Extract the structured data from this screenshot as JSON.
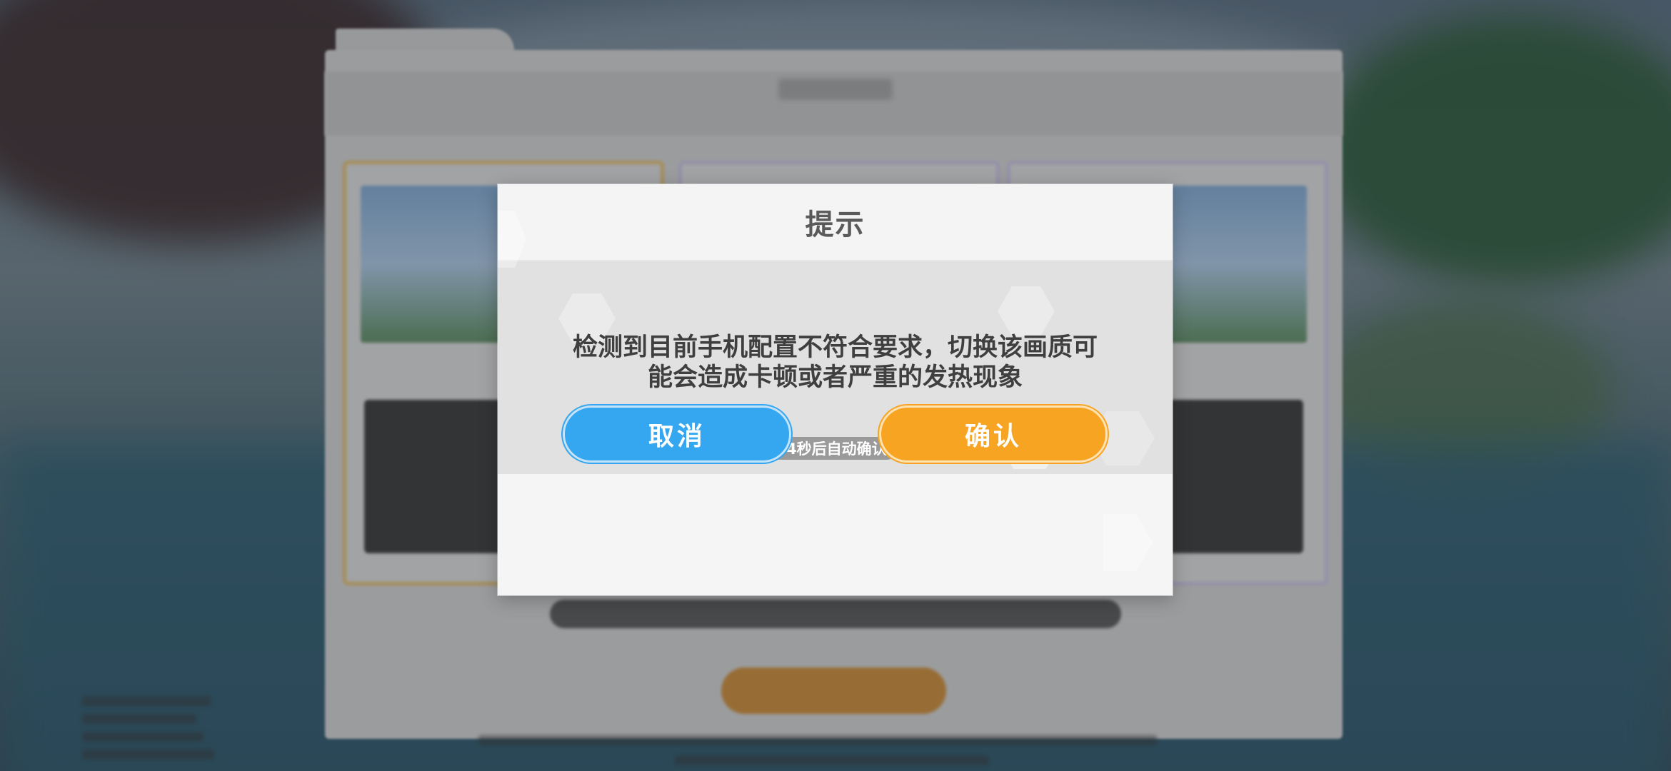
{
  "dialog": {
    "title": "提示",
    "message_line1": "检测到目前手机配置不符合要求，切换该画质可",
    "message_line2": "能会造成卡顿或者严重的发热现象",
    "countdown": "4秒后自动确认",
    "cancel_label": "取消",
    "confirm_label": "确认"
  },
  "icons": {
    "countdown": "alert-circle-icon"
  },
  "colors": {
    "cancel_button": "#35a6f0",
    "confirm_button": "#f8a423",
    "title_text": "#5a5a5a",
    "message_text": "#3f3f3f"
  }
}
